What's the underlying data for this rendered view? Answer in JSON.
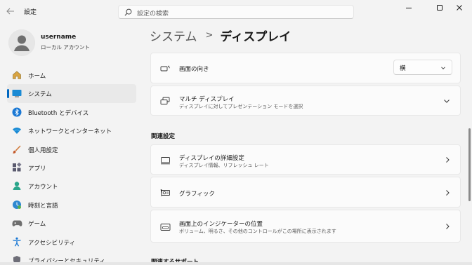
{
  "window": {
    "app_title": "設定",
    "search_placeholder": "設定の検索"
  },
  "profile": {
    "username": "username",
    "account_type": "ローカル アカウント"
  },
  "sidebar": {
    "items": [
      {
        "label": "ホーム",
        "icon": "home-icon"
      },
      {
        "label": "システム",
        "icon": "system-icon",
        "selected": true
      },
      {
        "label": "Bluetooth とデバイス",
        "icon": "bluetooth-icon"
      },
      {
        "label": "ネットワークとインターネット",
        "icon": "network-icon"
      },
      {
        "label": "個人用設定",
        "icon": "personalization-icon"
      },
      {
        "label": "アプリ",
        "icon": "apps-icon"
      },
      {
        "label": "アカウント",
        "icon": "account-icon"
      },
      {
        "label": "時刻と言語",
        "icon": "time-language-icon"
      },
      {
        "label": "ゲーム",
        "icon": "gaming-icon"
      },
      {
        "label": "アクセシビリティ",
        "icon": "accessibility-icon"
      },
      {
        "label": "プライバシーとセキュリティ",
        "icon": "privacy-icon"
      }
    ]
  },
  "breadcrumb": {
    "parent": "システム",
    "separator": ">",
    "current": "ディスプレイ"
  },
  "main": {
    "orientation": {
      "title": "画面の向き",
      "value": "横"
    },
    "multi_display": {
      "title": "マルチ ディスプレイ",
      "subtitle": "ディスプレイに対してプレゼンテーション モードを選択"
    },
    "related_header": "関連設定",
    "related": [
      {
        "title": "ディスプレイの詳細設定",
        "subtitle": "ディスプレイ情報、リフレッシュ レート",
        "icon": "monitor-icon"
      },
      {
        "title": "グラフィック",
        "subtitle": "",
        "icon": "graphics-card-icon"
      },
      {
        "title": "画面上のインジケーターの位置",
        "subtitle": "ボリューム、明るさ、その他のコントロールがこの場所に表示されます",
        "icon": "indicator-position-icon"
      }
    ],
    "support_header": "関連するサポート"
  },
  "colors": {
    "accent": "#0067c0",
    "background": "#f3f3f3",
    "card": "#fbfbfb"
  }
}
